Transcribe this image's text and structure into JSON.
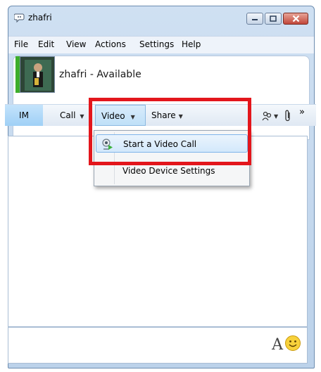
{
  "window": {
    "title": "zhafri",
    "minimize_icon": "minimize-icon",
    "maximize_icon": "maximize-icon",
    "close_icon": "close-icon"
  },
  "menubar": {
    "items": [
      {
        "label": "File"
      },
      {
        "label": "Edit"
      },
      {
        "label": "View"
      },
      {
        "label": "Actions"
      },
      {
        "label": "Settings"
      },
      {
        "label": "Help"
      }
    ]
  },
  "contact": {
    "name_status": "zhafri - Available",
    "presence_color": "#3dae2b"
  },
  "toolbar": {
    "im_label": "IM",
    "call_label": "Call",
    "video_label": "Video",
    "share_label": "Share",
    "caret": "▼",
    "overflow": "»"
  },
  "video_menu": {
    "items": [
      {
        "label": "Start a Video Call",
        "icon": "video-call-icon",
        "highlighted": true
      },
      {
        "label": "Video Device Settings"
      }
    ]
  },
  "compose": {
    "font_label": "A"
  },
  "colors": {
    "highlight_border": "#e3161c",
    "menu_hover": "#d3e8fb"
  }
}
